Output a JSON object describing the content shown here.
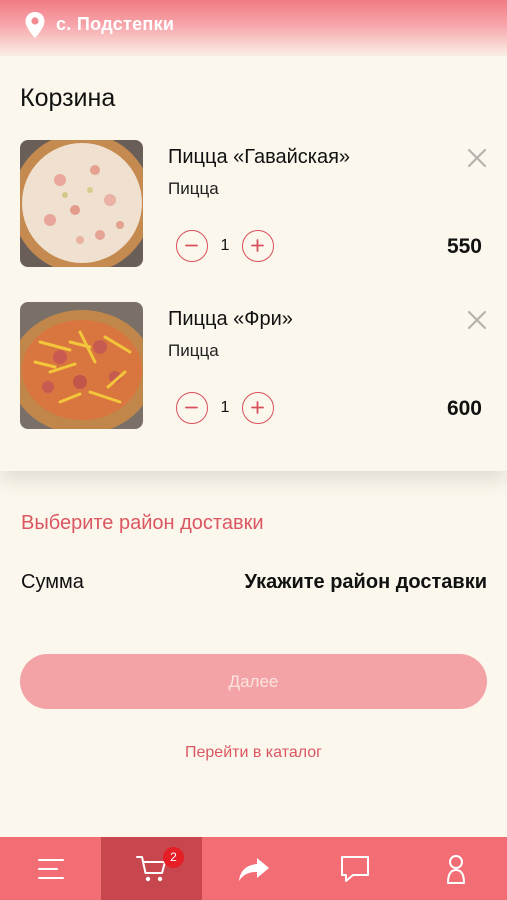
{
  "header": {
    "location": "с. Подстепки",
    "location_icon": "map-pin-icon"
  },
  "cart": {
    "title": "Корзина",
    "items": [
      {
        "name": "Пицца «Гавайская»",
        "category": "Пицца",
        "quantity": "1",
        "price": "550"
      },
      {
        "name": "Пицца «Фри»",
        "category": "Пицца",
        "quantity": "1",
        "price": "600"
      }
    ]
  },
  "delivery": {
    "select_district": "Выберите район доставки"
  },
  "summary": {
    "label": "Сумма",
    "value": "Укажите район доставки"
  },
  "actions": {
    "next": "Далее",
    "catalog": "Перейти в каталог"
  },
  "bottom_nav": {
    "items": [
      "menu-icon",
      "cart-icon",
      "share-icon",
      "chat-icon",
      "profile-icon"
    ],
    "cart_badge": "2",
    "active": "cart-icon"
  },
  "colors": {
    "accent": "#f26d74",
    "accent_dark": "#c8464d",
    "link": "#dc5662",
    "background": "#fbf7ec",
    "badge": "#e61e26"
  }
}
